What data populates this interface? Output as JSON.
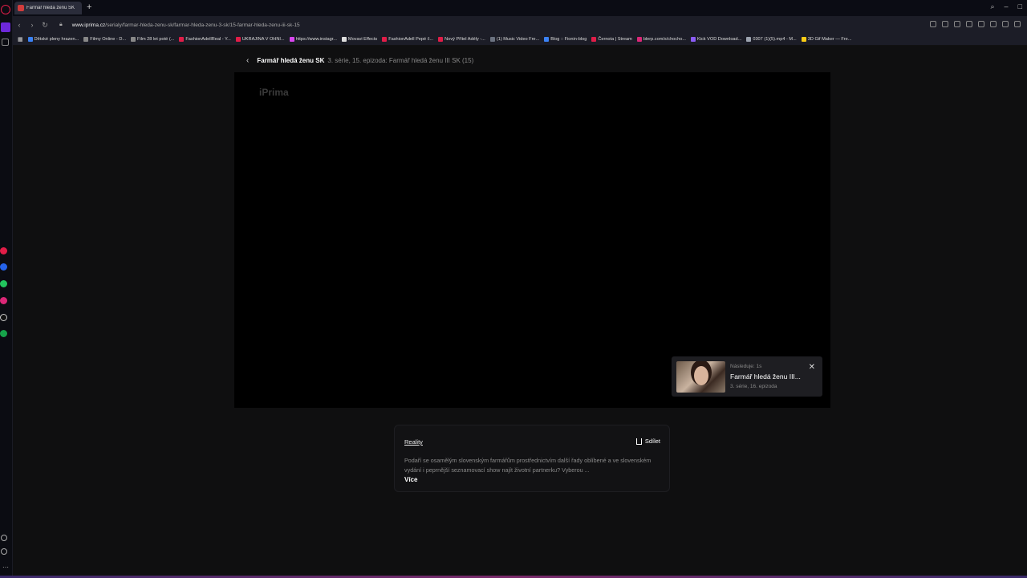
{
  "browser": {
    "tab_title": "Farmář hledá ženu SK",
    "new_tab": "+",
    "url_domain": "www.iprima.cz",
    "url_path": "/serialy/farmar-hleda-zenu-sk/farmar-hleda-zenu-3-sk/15-farmar-hleda-zenu-iii-sk-15",
    "bookmarks": [
      {
        "label": "Dětské pleny hrazen...",
        "color": "#3b82f6"
      },
      {
        "label": "Filmy Online - D...",
        "color": "#888888"
      },
      {
        "label": "Film 28 let poté (...",
        "color": "#888888"
      },
      {
        "label": "FashionAdellReal - Y...",
        "color": "#e11d48"
      },
      {
        "label": "UKRAJINA V OHNI...",
        "color": "#e11d48"
      },
      {
        "label": "https://www.instagr...",
        "color": "#d946ef"
      },
      {
        "label": "Movavi Effects",
        "color": "#dddddd"
      },
      {
        "label": "FashionAdell Pepé č...",
        "color": "#e11d48"
      },
      {
        "label": "Nový Přítel Adély -...",
        "color": "#e11d48"
      },
      {
        "label": "(1) Music Video Fre...",
        "color": "#6b7280"
      },
      {
        "label": "Blog :: Fionin-blog",
        "color": "#3b82f6"
      },
      {
        "label": "Černota | Stream",
        "color": "#e11d48"
      },
      {
        "label": "blerp.com/s/chocho...",
        "color": "#db2777"
      },
      {
        "label": "Kick VOD Download...",
        "color": "#8b5cf6"
      },
      {
        "label": "0307 (1)(5).mp4 - M...",
        "color": "#9ca3af"
      },
      {
        "label": "3D Gif Maker — Fre...",
        "color": "#facc15"
      }
    ]
  },
  "breadcrumb": {
    "back_icon": "‹",
    "show": "Farmář hledá ženu SK",
    "episode": "3. série, 15. epizoda: Farmář hledá ženu III SK (15)"
  },
  "player": {
    "watermark": "iPrima"
  },
  "next_up": {
    "label": "Následuje: 1s",
    "title": "Farmář hledá ženu III...",
    "subtitle": "3. série, 16. epizoda",
    "close_icon": "✕"
  },
  "info": {
    "genre": "Reality",
    "share_label": "Sdílet",
    "description": "Podaří se osamělým slovenským farmářům prostřednictvím další řady oblíbené a ve slovenském vydání i peprnější seznamovací show najít životní partnerku? Vyberou ...",
    "more_label": "Více"
  }
}
